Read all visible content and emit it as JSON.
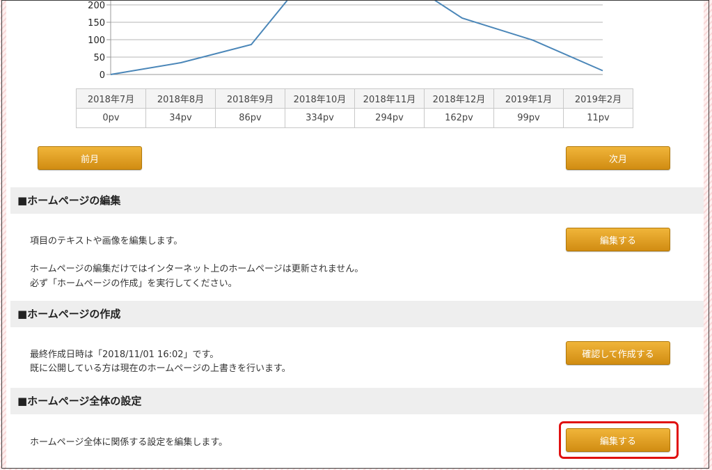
{
  "chart_data": {
    "type": "line",
    "x": [
      "2018年7月",
      "2018年8月",
      "2018年9月",
      "2018年10月",
      "2018年11月",
      "2018年12月",
      "2019年1月",
      "2019年2月"
    ],
    "series": [
      {
        "values": [
          0,
          34,
          86,
          334,
          294,
          162,
          99,
          11
        ]
      }
    ],
    "yticks": [
      0,
      50,
      100,
      150,
      200
    ],
    "ylim": [
      0,
      200
    ],
    "grid": true,
    "line_color": "#4a86b8"
  },
  "stats_table": {
    "months": [
      "2018年7月",
      "2018年8月",
      "2018年9月",
      "2018年10月",
      "2018年11月",
      "2018年12月",
      "2019年1月",
      "2019年2月"
    ],
    "pv": [
      "0pv",
      "34pv",
      "86pv",
      "334pv",
      "294pv",
      "162pv",
      "99pv",
      "11pv"
    ]
  },
  "nav": {
    "prev_label": "前月",
    "next_label": "次月"
  },
  "sections": {
    "edit": {
      "title": "■ホームページの編集",
      "line1": "項目のテキストや画像を編集します。",
      "line2": "ホームページの編集だけではインターネット上のホームページは更新されません。",
      "line3": "必ず「ホームページの作成」を実行してください。",
      "button": "編集する"
    },
    "create": {
      "title": "■ホームページの作成",
      "line1": "最終作成日時は「2018/11/01 16:02」です。",
      "line2": "既に公開している方は現在のホームページの上書きを行います。",
      "button": "確認して作成する"
    },
    "settings": {
      "title": "■ホームページ全体の設定",
      "line1": "ホームページ全体に関係する設定を編集します。",
      "button": "編集する"
    }
  },
  "colors": {
    "button_bg": "#e0a020",
    "highlight": "#e01010",
    "section_bg": "#eeeeee",
    "line": "#4a86b8"
  }
}
